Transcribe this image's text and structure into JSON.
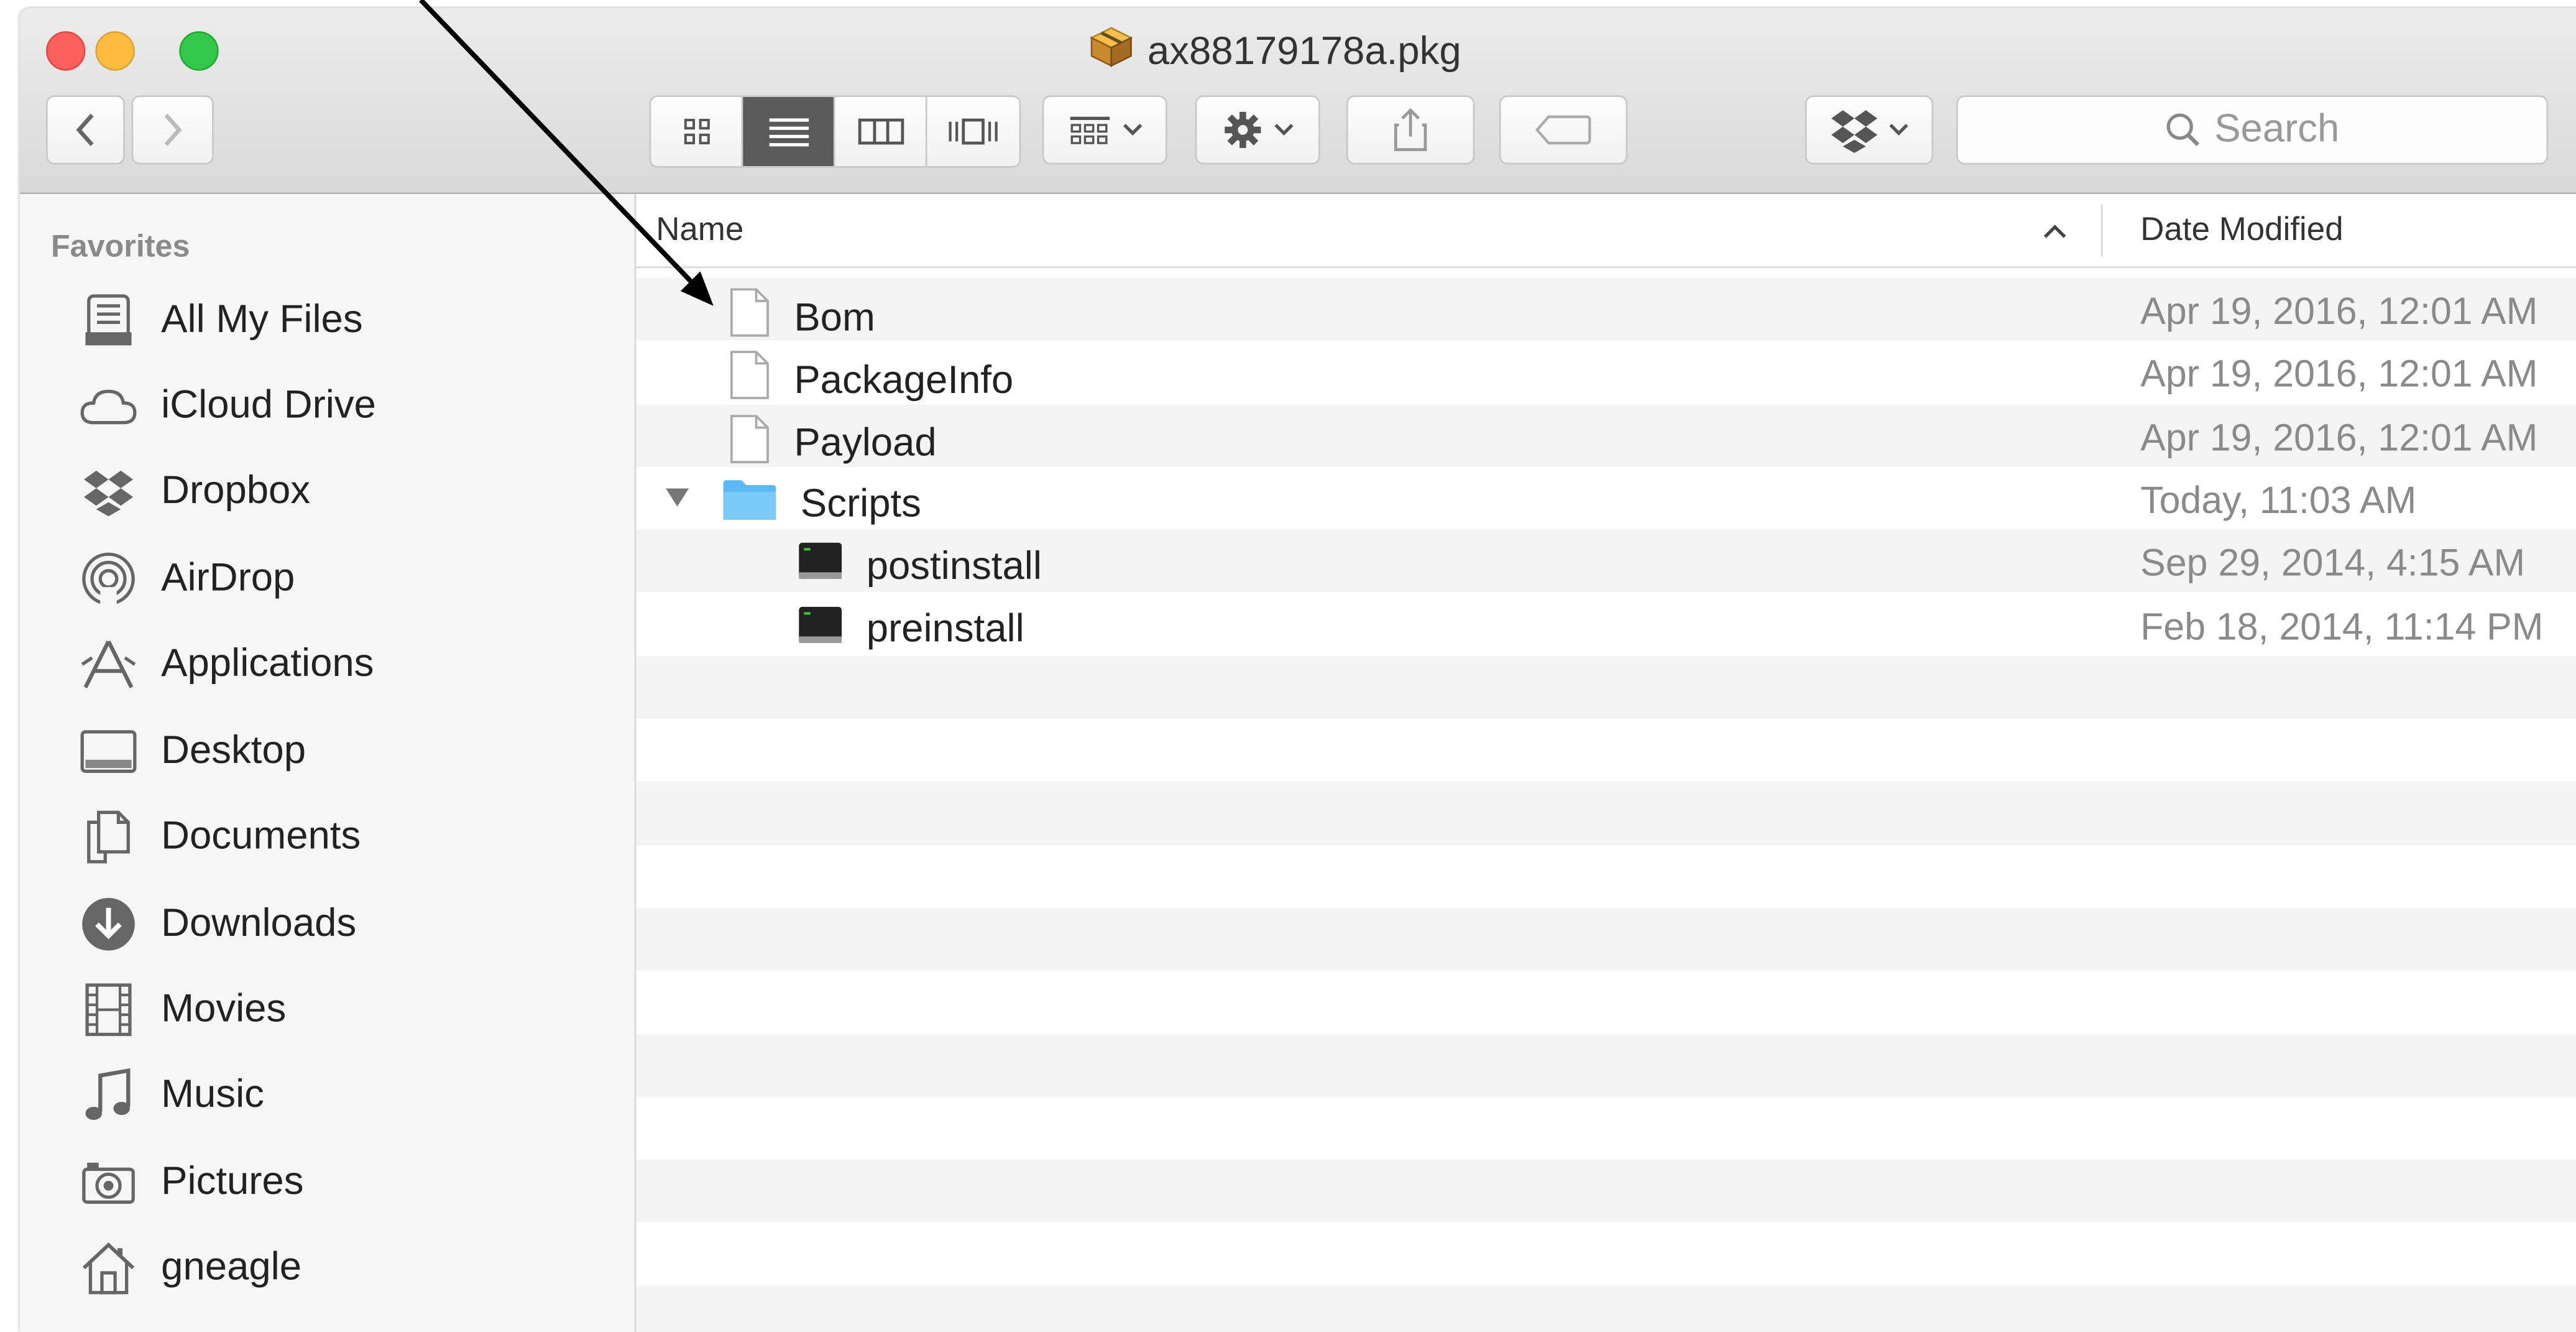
{
  "window": {
    "title": "ax88179178a.pkg",
    "search_placeholder": "Search"
  },
  "sidebar": {
    "section": "Favorites",
    "items": [
      {
        "label": "All My Files"
      },
      {
        "label": "iCloud Drive"
      },
      {
        "label": "Dropbox"
      },
      {
        "label": "AirDrop"
      },
      {
        "label": "Applications"
      },
      {
        "label": "Desktop"
      },
      {
        "label": "Documents"
      },
      {
        "label": "Downloads"
      },
      {
        "label": "Movies"
      },
      {
        "label": "Music"
      },
      {
        "label": "Pictures"
      },
      {
        "label": "gneagle"
      }
    ]
  },
  "columns": {
    "name": "Name",
    "date": "Date Modified"
  },
  "files": [
    {
      "name": "Bom",
      "date": "Apr 19, 2016, 12:01 AM",
      "kind": "document"
    },
    {
      "name": "PackageInfo",
      "date": "Apr 19, 2016, 12:01 AM",
      "kind": "document"
    },
    {
      "name": "Payload",
      "date": "Apr 19, 2016, 12:01 AM",
      "kind": "document"
    },
    {
      "name": "Scripts",
      "date": "Today, 11:03 AM",
      "kind": "folder",
      "expanded": true
    },
    {
      "name": "postinstall",
      "date": "Sep 29, 2014, 4:15 AM",
      "kind": "executable"
    },
    {
      "name": "preinstall",
      "date": "Feb 18, 2014, 11:14 PM",
      "kind": "executable"
    }
  ],
  "colors": {
    "close": "#fc605b",
    "minimize": "#fdbc40",
    "zoom": "#34c84a",
    "folder": "#5bb8f5",
    "active_segment": "#5a5a5a"
  }
}
